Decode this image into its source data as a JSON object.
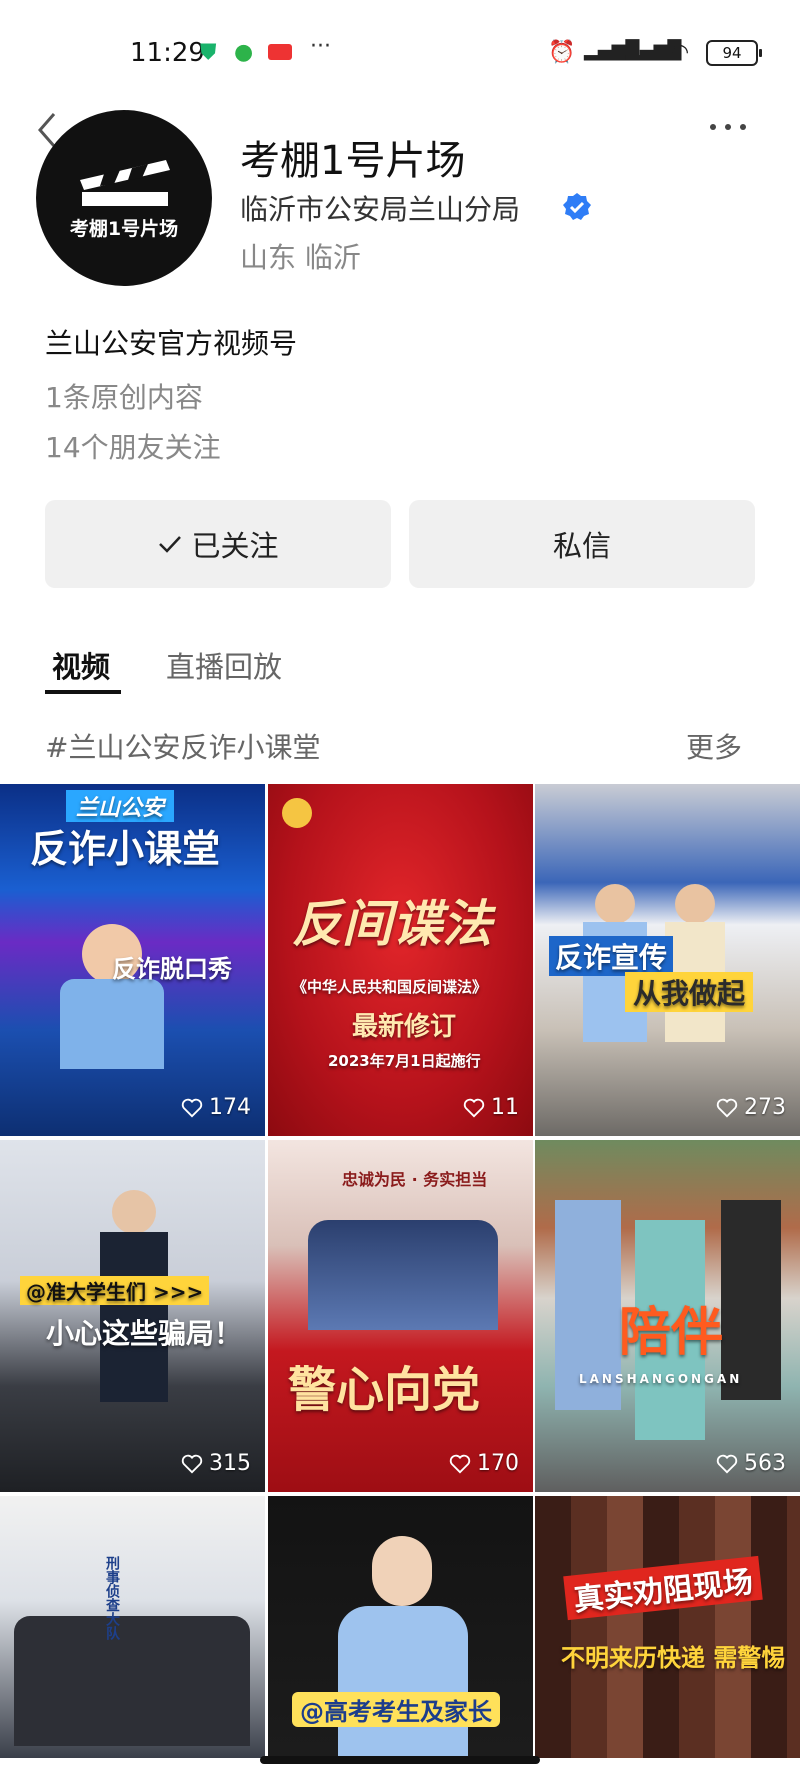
{
  "status_bar": {
    "time": "11:29",
    "battery": "94"
  },
  "profile": {
    "name": "考棚1号片场",
    "avatar_text": "考棚1号片场",
    "organization": "临沂市公安局兰山分局",
    "location": "山东 临沂",
    "bio": "兰山公安官方视频号",
    "original_count": "1条原创内容",
    "friends_following": "14个朋友关注"
  },
  "actions": {
    "follow_label": "已关注",
    "message_label": "私信"
  },
  "tabs": [
    {
      "label": "视频"
    },
    {
      "label": "直播回放"
    }
  ],
  "topic": {
    "label": "#兰山公安反诈小课堂",
    "more_label": "更多"
  },
  "videos": [
    {
      "likes": "174",
      "title": "反诈小课堂",
      "subtitle": "兰山公安",
      "badge": "反诈脱口秀"
    },
    {
      "likes": "11",
      "title": "反间谍法",
      "subtitle": "《中华人民共和国反间谍法》",
      "badge": "最新修订",
      "note": "2023年7月1日起施行"
    },
    {
      "likes": "273",
      "title": "反诈宣传",
      "subtitle": "从我做起"
    },
    {
      "likes": "315",
      "title": "小心这些骗局！",
      "subtitle": "@准大学生们 >>>"
    },
    {
      "likes": "170",
      "title": "警心向党",
      "subtitle": "忠诚为民 · 务实担当"
    },
    {
      "likes": "563",
      "title": "陪伴",
      "subtitle": "LANSHANGONGAN"
    },
    {
      "title": "刑事侦查大队"
    },
    {
      "title": "@高考考生及家长"
    },
    {
      "title": "真实劝阻现场",
      "subtitle": "不明来历快递 需警惕"
    }
  ],
  "colors": {
    "verify_blue": "#2f7df6",
    "button_bg": "#f0f0f0"
  }
}
